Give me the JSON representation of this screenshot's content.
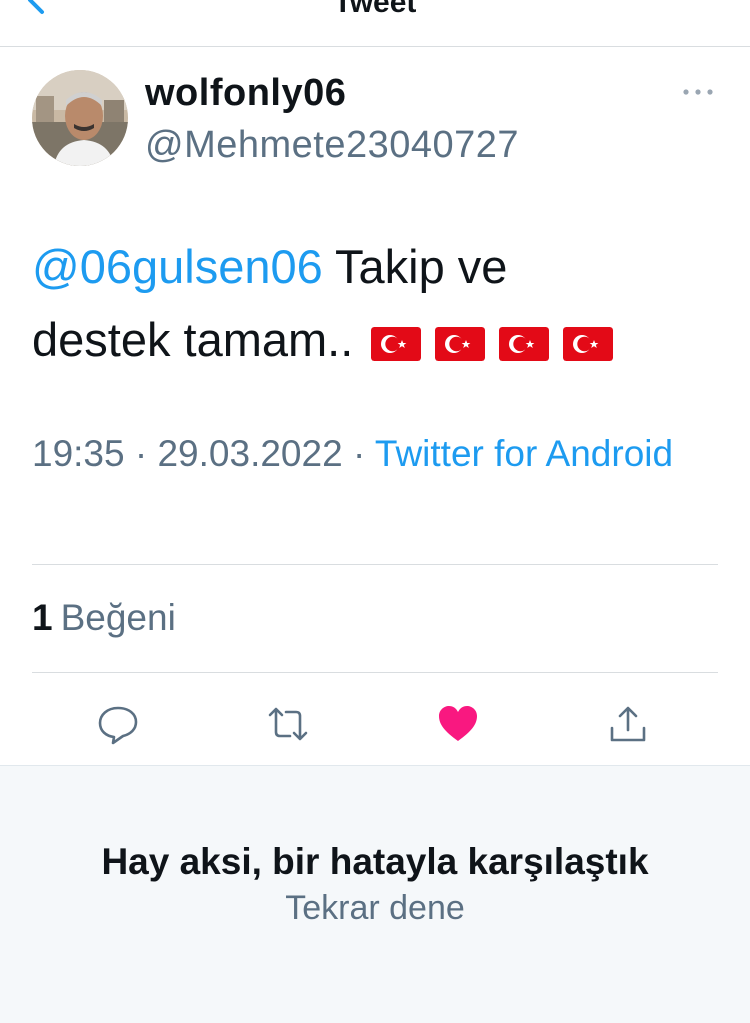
{
  "header": {
    "title": "Tweet"
  },
  "tweet": {
    "author": {
      "display_name": "wolfonly06",
      "handle": "@Mehmete23040727"
    },
    "mention": "@06gulsen06",
    "text_line1": " Takip ve",
    "text_line2": "destek tamam..",
    "flags": [
      "turkey-flag",
      "turkey-flag",
      "turkey-flag",
      "turkey-flag"
    ],
    "time": "19:35",
    "separator": " · ",
    "date": "29.03.2022",
    "source": "Twitter for Android",
    "likes_count": "1",
    "likes_label": "Beğeni"
  },
  "actions": [
    "reply-icon",
    "retweet-icon",
    "like-icon",
    "share-icon"
  ],
  "colors": {
    "accent": "#1d9bf0",
    "like": "#f91880",
    "flag": "#e30a17",
    "muted": "#5b7083"
  },
  "error": {
    "title": "Hay aksi, bir hatayla karşılaştık",
    "retry": "Tekrar dene"
  }
}
